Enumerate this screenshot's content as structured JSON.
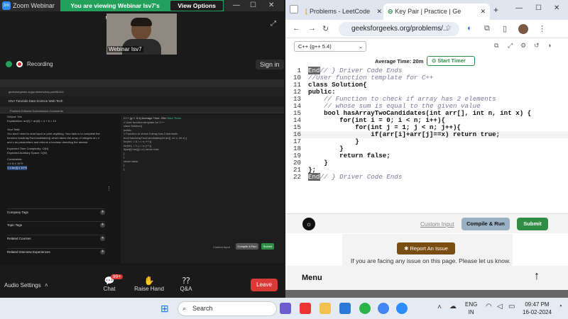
{
  "zoom": {
    "title": "Zoom Webinar",
    "banner": "You are viewing Webinar Isv7's screen",
    "view_options": "View Options",
    "participant_name": "Webinar Isv7",
    "recording": "Recording",
    "sign_in": "Sign in",
    "audio_settings": "Audio Settings",
    "chat": "Chat",
    "chat_badge": "99+",
    "raise_hand": "Raise Hand",
    "qa": "Q&A",
    "leave": "Leave",
    "mini": {
      "url": "geeksforgeeks.org/problems/key-pair5616/1",
      "tab_labels": "DSA   Tutorials   Data Science   Web Tech",
      "sub_tabs": "Problem   Editorial   Submissions   Comments",
      "lp_lines": [
        "Output: Yes",
        "Explanation: arr[2] + arr[4] = 4 + 6 = 10",
        "Your Task:",
        "You don't need to read input or print anything. Your task is to complete the",
        "function hasArrayTwoCandidates() which takes the array of integers arr, n",
        "and x as parameters and returns a boolean denoting the answer.",
        "Expected Time Complexity: O(N)",
        "Expected Auxiliary Space: O(N)",
        "Constraints:",
        "1 ≤ N ≤ 10^5",
        "1 ≤ Arr[i] ≤ 10^5"
      ],
      "accordions": [
        "Company Tags",
        "Topic Tags",
        "Related Courses",
        "Related Interview Experiences"
      ],
      "avg_time": "Average Time: 20m",
      "start_timer": "Start Timer",
      "lang": "C++ (g++ 5.4)",
      "compile": "Compile & Run",
      "submit": "Submit",
      "custom": "Custom Input"
    }
  },
  "chrome": {
    "tabs": [
      {
        "label": "Problems - LeetCode"
      },
      {
        "label": "Key Pair | Practice | Ge"
      }
    ],
    "url": "geeksforgeeks.org/problems/...",
    "language": "C++ (g++ 5.4)",
    "avg_time": "Average Time: 20m",
    "start_timer": "Start Timer",
    "code_lines": [
      {
        "n": "1",
        "html": "<span style=\"background:#666;color:#fff\">End</span><span class=\"cm\">// } Driver Code Ends</span>"
      },
      {
        "n": "10",
        "html": "<span class=\"cm\">//User function template for C++</span>"
      },
      {
        "n": "11",
        "html": "<span class=\"kw\">class Solution{</span>"
      },
      {
        "n": "12",
        "html": "<span class=\"kw\">public:</span>"
      },
      {
        "n": "13",
        "html": "    <span class=\"cm\">// Function to check if array has 2 elements</span>"
      },
      {
        "n": "14",
        "html": "    <span class=\"cm\">// whose sum is equal to the given value</span>"
      },
      {
        "n": "15",
        "html": "    <span class=\"kw\">bool hasArrayTwoCandidates(int arr[], int n, int x) {</span>"
      },
      {
        "n": "14",
        "html": "        <span class=\"kw\">for(int i = 0; i &lt; n; i++){</span>"
      },
      {
        "n": "15",
        "html": "            <span class=\"kw\">for(int j = 1; j &lt; n; j++){</span>"
      },
      {
        "n": "16",
        "html": "                <span class=\"kw\">if(arr[i]+arr[j]==x) return true;</span>"
      },
      {
        "n": "17",
        "html": "            <span class=\"kw\">}</span>"
      },
      {
        "n": "18",
        "html": "        <span class=\"kw\">}</span>"
      },
      {
        "n": "19",
        "html": "        <span class=\"kw\">return false;</span>"
      },
      {
        "n": "20",
        "html": "    <span class=\"kw\">}</span>"
      },
      {
        "n": "21",
        "html": "<span class=\"kw\">};</span>"
      },
      {
        "n": "22",
        "html": "<span style=\"background:#666;color:#fff\">End</span><span class=\"cm\">// } Driver Code Ends</span>"
      }
    ],
    "custom_input": "Custom Input",
    "compile": "Compile & Run",
    "submit": "Submit",
    "report_button": "Report An Issue",
    "report_msg": "If you are facing any issue on this page. Please let us know.",
    "menu": "Menu"
  },
  "taskbar": {
    "search": "Search",
    "lang1": "ENG",
    "lang2": "IN",
    "time": "09:47 PM",
    "date": "16-02-2024"
  }
}
